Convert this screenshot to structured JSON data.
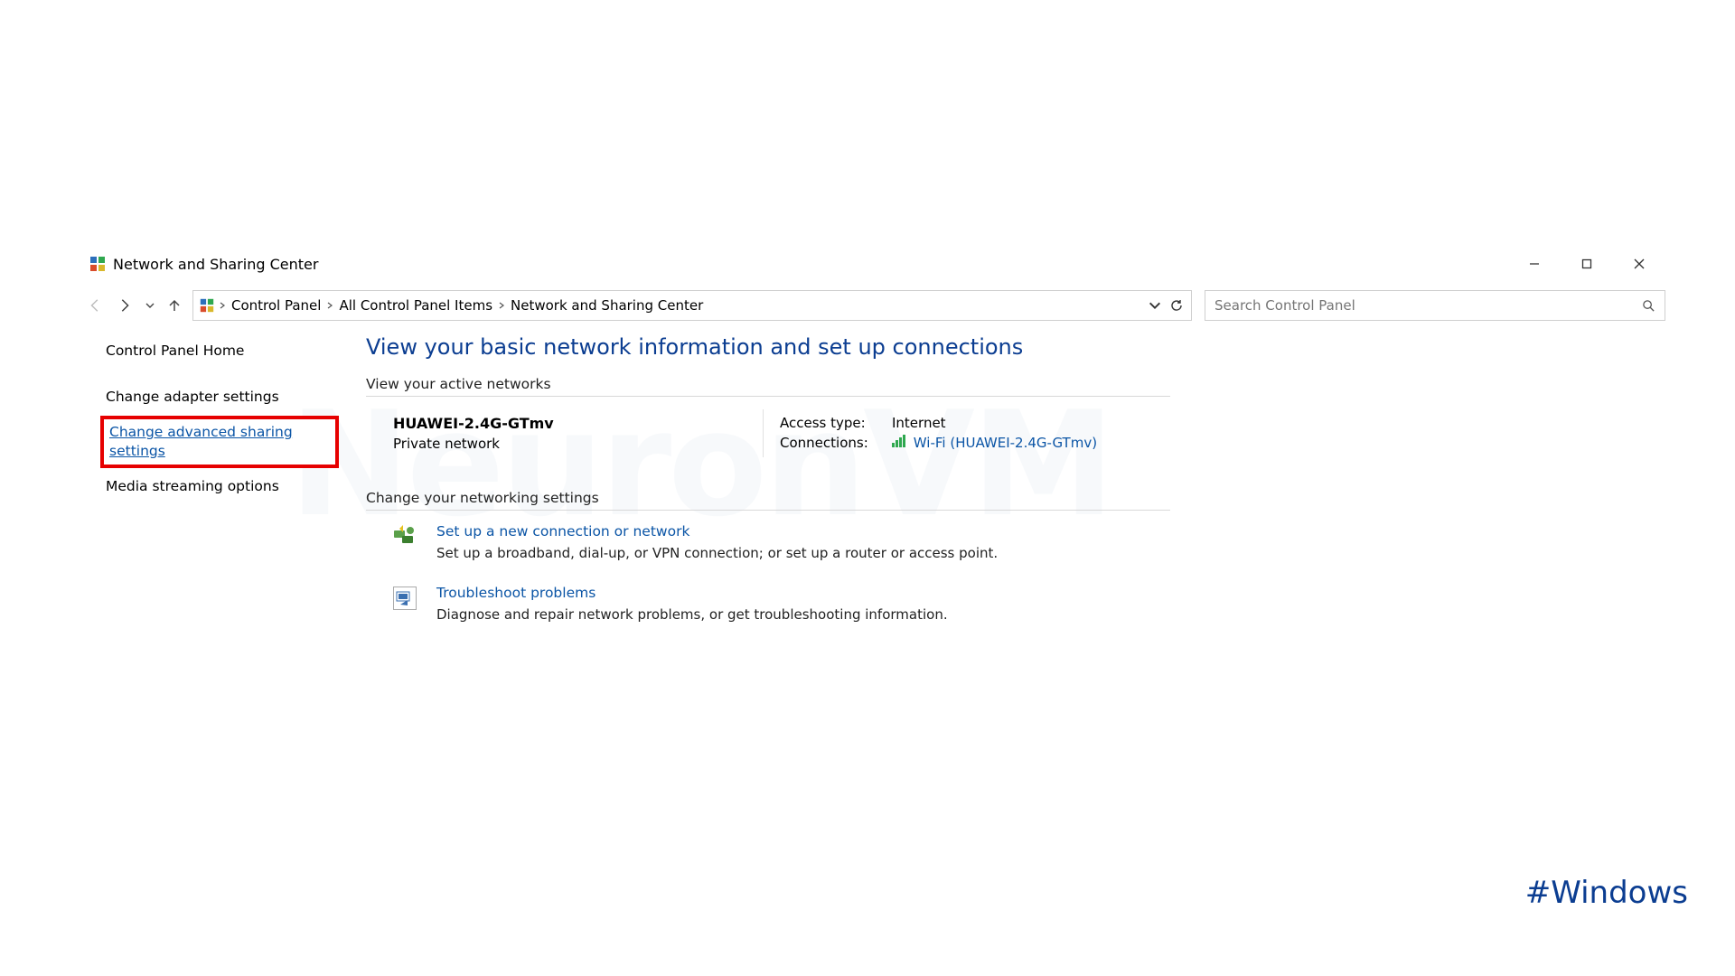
{
  "window": {
    "title": "Network and Sharing Center"
  },
  "breadcrumb": {
    "root": "Control Panel",
    "mid": "All Control Panel Items",
    "leaf": "Network and Sharing Center"
  },
  "search": {
    "placeholder": "Search Control Panel"
  },
  "sidebar": {
    "items": [
      {
        "label": "Control Panel Home"
      },
      {
        "label": "Change adapter settings"
      },
      {
        "label": "Change advanced sharing settings",
        "highlighted": true
      },
      {
        "label": "Media streaming options"
      }
    ]
  },
  "page": {
    "title": "View your basic network information and set up connections",
    "active_networks_header": "View your active networks",
    "network": {
      "name": "HUAWEI-2.4G-GTmv",
      "type": "Private network",
      "access_label": "Access type:",
      "access_value": "Internet",
      "connections_label": "Connections:",
      "connection_link": "Wi-Fi (HUAWEI-2.4G-GTmv)"
    },
    "change_settings_header": "Change your networking settings",
    "options": [
      {
        "title": "Set up a new connection or network",
        "desc": "Set up a broadband, dial-up, or VPN connection; or set up a router or access point."
      },
      {
        "title": "Troubleshoot problems",
        "desc": "Diagnose and repair network problems, or get troubleshooting information."
      }
    ]
  },
  "watermark": "NeuronVM",
  "hashtag": "#Windows"
}
